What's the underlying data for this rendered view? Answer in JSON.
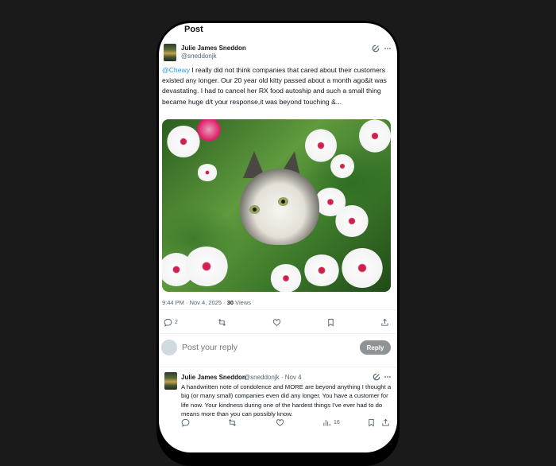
{
  "header": {
    "title": "Post"
  },
  "post": {
    "author_name": "Julie James Sneddon",
    "author_handle": "@sneddonjk",
    "mention": "@Chewy",
    "text": " I really did not think companies that cared about their customers existed any longer. Our 20 year old kitty passed about a month ago&it was devastating. I had to cancel her RX food autoship and such a small thing became huge d/t your response,it was beyond touching &...",
    "time": "9:44 PM · Nov 4, 2025 · ",
    "views_count": "30",
    "views_label": " Views",
    "actions": {
      "reply_count": "2"
    }
  },
  "composer": {
    "placeholder": "Post your reply",
    "button_label": "Reply"
  },
  "reply": {
    "author_name": "Julie James Sneddon",
    "author_handle": "@sneddonjk · Nov 4",
    "text": "A handwritten note of condolence and MORE are beyond anything I thought a big (or many small) companies even did any longer. You have a customer for life now. Your kindness during one of the hardest things I've ever had to do means more than you can possibly know.",
    "views_count": "16"
  },
  "icons": [
    "grok-icon",
    "more-icon",
    "reply-icon",
    "repost-icon",
    "like-icon",
    "bookmark-icon",
    "share-icon",
    "views-icon"
  ]
}
